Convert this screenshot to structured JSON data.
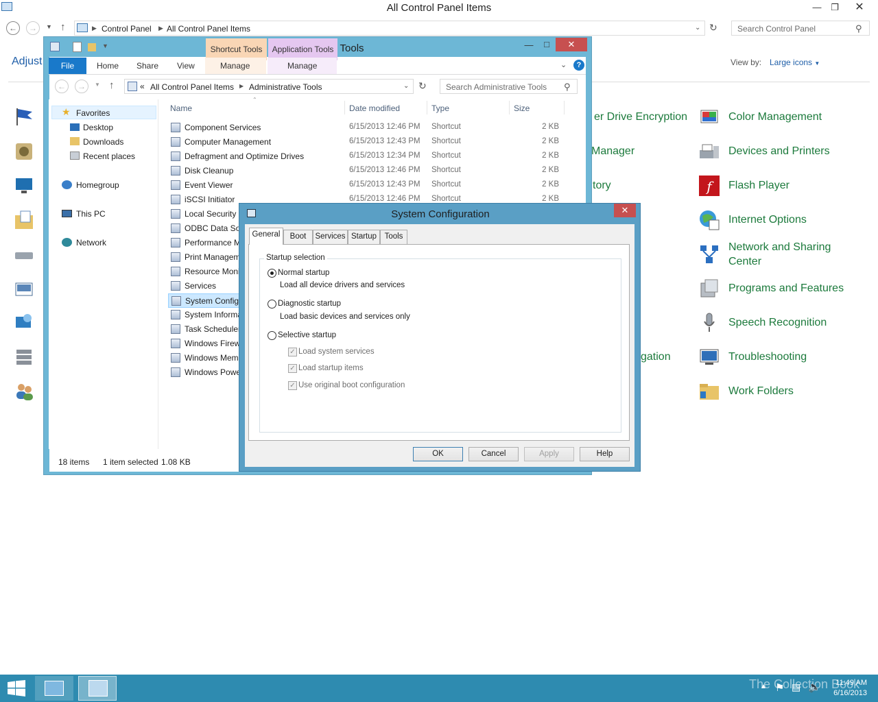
{
  "control_panel": {
    "title": "All Control Panel Items",
    "breadcrumbs": [
      "Control Panel",
      "All Control Panel Items"
    ],
    "search_placeholder": "Search Control Panel",
    "adjust_text": "Adjust",
    "view_by_label": "View by:",
    "view_by_value": "Large icons",
    "items_right": [
      "Color Management",
      "Devices and Printers",
      "Flash Player",
      "Internet Options",
      "Network and Sharing Center",
      "Programs and Features",
      "Speech Recognition",
      "Troubleshooting",
      "Work Folders"
    ],
    "items_partial": [
      "er Drive Encryption",
      "Manager",
      "tory",
      "gation"
    ]
  },
  "admin_tools": {
    "title": "Administrative Tools",
    "contextual_tabs": [
      "Shortcut Tools",
      "Application Tools"
    ],
    "ribbon_tabs": [
      "File",
      "Home",
      "Share",
      "View",
      "Manage",
      "Manage"
    ],
    "breadcrumb_prefix": "«",
    "breadcrumbs": [
      "All Control Panel Items",
      "Administrative Tools"
    ],
    "search_placeholder": "Search Administrative Tools",
    "nav": {
      "favorites": "Favorites",
      "favorites_items": [
        "Desktop",
        "Downloads",
        "Recent places"
      ],
      "homegroup": "Homegroup",
      "this_pc": "This PC",
      "network": "Network"
    },
    "columns": [
      "Name",
      "Date modified",
      "Type",
      "Size"
    ],
    "rows": [
      {
        "name": "Component Services",
        "date": "6/15/2013 12:46 PM",
        "type": "Shortcut",
        "size": "2 KB"
      },
      {
        "name": "Computer Management",
        "date": "6/15/2013 12:43 PM",
        "type": "Shortcut",
        "size": "2 KB"
      },
      {
        "name": "Defragment and Optimize Drives",
        "date": "6/15/2013 12:34 PM",
        "type": "Shortcut",
        "size": "2 KB"
      },
      {
        "name": "Disk Cleanup",
        "date": "6/15/2013 12:46 PM",
        "type": "Shortcut",
        "size": "2 KB"
      },
      {
        "name": "Event Viewer",
        "date": "6/15/2013 12:43 PM",
        "type": "Shortcut",
        "size": "2 KB"
      },
      {
        "name": "iSCSI Initiator",
        "date": "6/15/2013 12:46 PM",
        "type": "Shortcut",
        "size": "2 KB"
      },
      {
        "name": "Local Security P",
        "date": "",
        "type": "",
        "size": ""
      },
      {
        "name": "ODBC Data Sou",
        "date": "",
        "type": "",
        "size": ""
      },
      {
        "name": "Performance M",
        "date": "",
        "type": "",
        "size": ""
      },
      {
        "name": "Print Managem",
        "date": "",
        "type": "",
        "size": ""
      },
      {
        "name": "Resource Moni",
        "date": "",
        "type": "",
        "size": ""
      },
      {
        "name": "Services",
        "date": "",
        "type": "",
        "size": ""
      },
      {
        "name": "System Configu",
        "date": "",
        "type": "",
        "size": ""
      },
      {
        "name": "System Informa",
        "date": "",
        "type": "",
        "size": ""
      },
      {
        "name": "Task Scheduler",
        "date": "",
        "type": "",
        "size": ""
      },
      {
        "name": "Windows Firew",
        "date": "",
        "type": "",
        "size": ""
      },
      {
        "name": "Windows Mem",
        "date": "",
        "type": "",
        "size": ""
      },
      {
        "name": "Windows Powe",
        "date": "",
        "type": "",
        "size": ""
      }
    ],
    "status": {
      "count": "18 items",
      "selected": "1 item selected",
      "size": "1.08 KB"
    }
  },
  "system_config": {
    "title": "System Configuration",
    "tabs": [
      "General",
      "Boot",
      "Services",
      "Startup",
      "Tools"
    ],
    "group_label": "Startup selection",
    "normal_label": "Normal startup",
    "normal_desc": "Load all device drivers and services",
    "diagnostic_label": "Diagnostic startup",
    "diagnostic_desc": "Load basic devices and services only",
    "selective_label": "Selective startup",
    "checkboxes": [
      "Load system services",
      "Load startup items",
      "Use original boot configuration"
    ],
    "buttons": {
      "ok": "OK",
      "cancel": "Cancel",
      "apply": "Apply",
      "help": "Help"
    }
  },
  "taskbar": {
    "time": "11:49 AM",
    "date": "6/16/2013",
    "watermark": "The Collection Book"
  },
  "colors": {
    "accent_blue": "#1979ca",
    "link_green": "#1c7a3c",
    "close_red": "#c75050",
    "taskbar": "#2e8bb0",
    "dialog_frame": "#5a9fc5",
    "explorer_frame": "#6db7d6"
  }
}
